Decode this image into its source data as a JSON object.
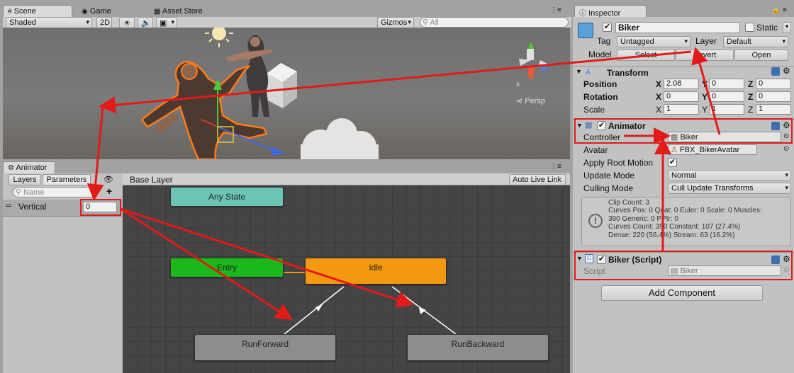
{
  "tabs": {
    "scene": "Scene",
    "game": "Game",
    "asset_store": "Asset Store",
    "inspector": "Inspector",
    "animator": "Animator"
  },
  "scene_toolbar": {
    "shading": "Shaded",
    "mode_2d": "2D",
    "gizmos": "Gizmos",
    "search_placeholder": "All",
    "persp": "Persp",
    "axis_x": "x"
  },
  "animator": {
    "tab_layers": "Layers",
    "tab_parameters": "Parameters",
    "search_placeholder": "Name",
    "add": "+",
    "breadcrumb": "Base Layer",
    "auto_live_link": "Auto Live Link",
    "parameter": {
      "name": "Vertical",
      "value": "0"
    },
    "states": {
      "any": "Any State",
      "entry": "Entry",
      "idle": "Idle",
      "run_forward": "RunForward",
      "run_backward": "RunBackward"
    }
  },
  "inspector": {
    "object_name": "Biker",
    "static_label": "Static",
    "tag_label": "Tag",
    "tag_value": "Untagged",
    "layer_label": "Layer",
    "layer_value": "Default",
    "model_label": "Model",
    "model_select": "Select",
    "model_revert": "Revert",
    "model_open": "Open",
    "transform": {
      "title": "Transform",
      "position": {
        "label": "Position",
        "x": "2.08",
        "y": "0",
        "z": "0"
      },
      "rotation": {
        "label": "Rotation",
        "x": "0",
        "y": "0",
        "z": "0"
      },
      "scale": {
        "label": "Scale",
        "x": "1",
        "y": "1",
        "z": "1"
      }
    },
    "axis": {
      "x": "X",
      "y": "Y",
      "z": "Z"
    },
    "animator_comp": {
      "title": "Animator",
      "controller_label": "Controller",
      "controller_value": "Biker",
      "avatar_label": "Avatar",
      "avatar_value": "FBX_BikerAvatar",
      "apply_root_label": "Apply Root Motion",
      "update_mode_label": "Update Mode",
      "update_mode_value": "Normal",
      "culling_mode_label": "Culling Mode",
      "culling_mode_value": "Cull Update Transforms",
      "info_lines": [
        "Clip Count: 3",
        "Curves Pos: 0 Quat: 0 Euler: 0 Scale: 0 Muscles:",
        "390 Generic: 0 PPtr: 0",
        "Curves Count: 390 Constant: 107 (27.4%)",
        "Dense: 220 (56.4%) Stream: 63 (16.2%)"
      ]
    },
    "script_comp": {
      "title": "Biker (Script)",
      "script_label": "Script",
      "script_value": "Biker"
    },
    "add_component": "Add Component"
  },
  "colors": {
    "any_state": "#6cc4b5",
    "entry": "#1bb81b",
    "idle": "#f3990f",
    "state_gray": "#8d8d8d",
    "highlight": "#e21a1a"
  }
}
